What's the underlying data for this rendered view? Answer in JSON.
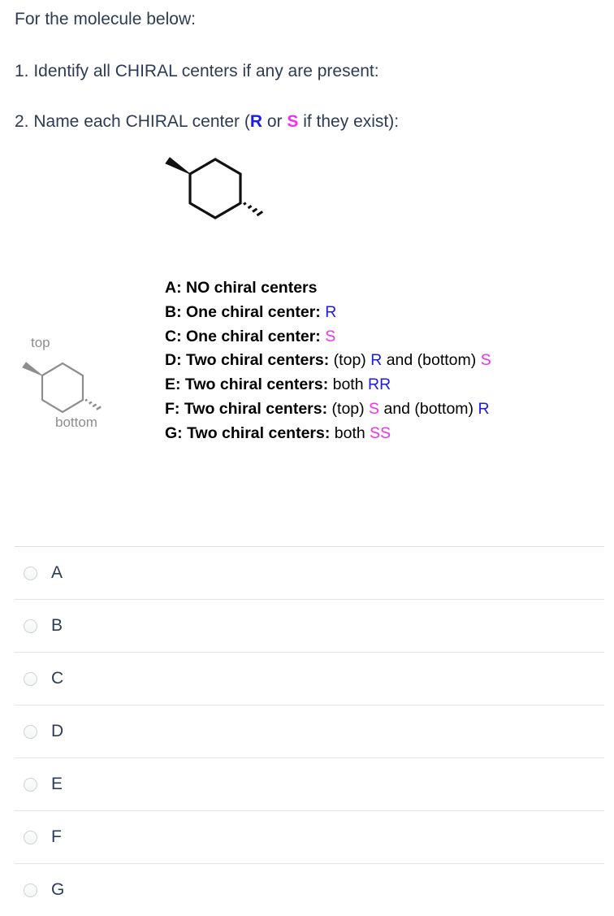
{
  "prompt": {
    "line1": "For the molecule below:",
    "line2": "1. Identify all CHIRAL centers if any are present:",
    "line3_pre": "2. Name each CHIRAL center (",
    "line3_r": "R",
    "line3_mid": " or ",
    "line3_s": "S",
    "line3_post": " if they exist):"
  },
  "molecule": {
    "name": "cyclohexane-ring",
    "wedge_bond": "bold-wedge",
    "hash_bond": "hashed-wedge",
    "label_top": "top",
    "label_bottom": "bottom",
    "main_color": "#111111",
    "gray_color": "#8d8d8d"
  },
  "colors": {
    "R": "#1b1bea",
    "S": "#f22ff2",
    "text": "#2d3b55",
    "separator": "#e2e4e6"
  },
  "options": [
    {
      "head": "A: NO chiral centers",
      "parts": []
    },
    {
      "head": "B: One chiral center:",
      "parts": [
        {
          "text": " R",
          "kind": "R"
        }
      ]
    },
    {
      "head": "C: One chiral center:",
      "parts": [
        {
          "text": " S",
          "kind": "S"
        }
      ]
    },
    {
      "head": "D: Two chiral centers:",
      "parts": [
        {
          "text": " (top) ",
          "kind": "plain"
        },
        {
          "text": "R",
          "kind": "R"
        },
        {
          "text": " and (bottom) ",
          "kind": "plain"
        },
        {
          "text": "S",
          "kind": "S"
        }
      ]
    },
    {
      "head": "E: Two chiral centers:",
      "parts": [
        {
          "text": " both ",
          "kind": "plain"
        },
        {
          "text": "RR",
          "kind": "R"
        }
      ]
    },
    {
      "head": "F: Two chiral centers:",
      "parts": [
        {
          "text": " (top) ",
          "kind": "plain"
        },
        {
          "text": "S",
          "kind": "S"
        },
        {
          "text": " and (bottom) ",
          "kind": "plain"
        },
        {
          "text": "R",
          "kind": "R"
        }
      ]
    },
    {
      "head": "G: Two chiral centers:",
      "parts": [
        {
          "text": " both ",
          "kind": "plain"
        },
        {
          "text": "SS",
          "kind": "S"
        }
      ]
    }
  ],
  "choices": [
    {
      "label": "A",
      "selected": false
    },
    {
      "label": "B",
      "selected": false
    },
    {
      "label": "C",
      "selected": false
    },
    {
      "label": "D",
      "selected": false
    },
    {
      "label": "E",
      "selected": false
    },
    {
      "label": "F",
      "selected": false
    },
    {
      "label": "G",
      "selected": false
    }
  ]
}
